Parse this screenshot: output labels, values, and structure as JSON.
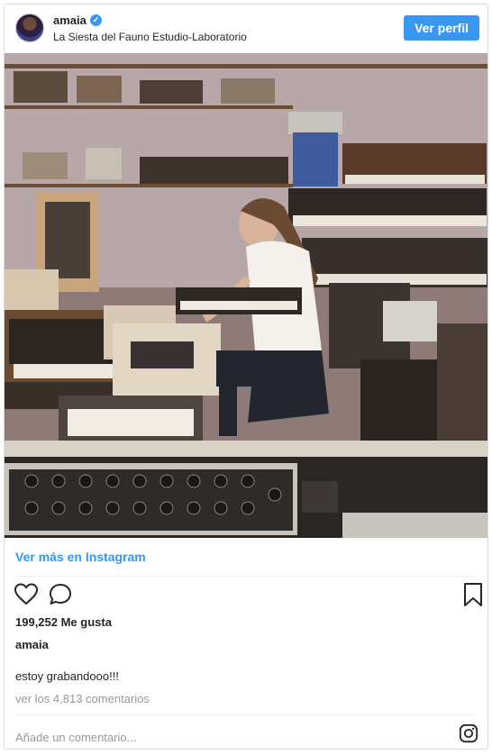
{
  "header": {
    "username": "amaia",
    "verified_icon": "verified-badge-icon",
    "location": "La Siesta del Fauno Estudio-Laboratorio",
    "follow_label": "Ver perfil"
  },
  "post": {
    "image_icon": "photo",
    "more_link": "Ver más en Instagram",
    "likes": "199,252 Me gusta",
    "author": "amaia",
    "caption": "estoy grabandooo!!!",
    "comments_link": "ver los 4,813 comentarios",
    "comment_placeholder": "Añade un comentario..."
  },
  "colors": {
    "accent": "#3897f0",
    "muted": "#999999",
    "text": "#262626"
  },
  "icons": [
    "heart-icon",
    "comment-icon",
    "bookmark-icon",
    "instagram-icon"
  ]
}
